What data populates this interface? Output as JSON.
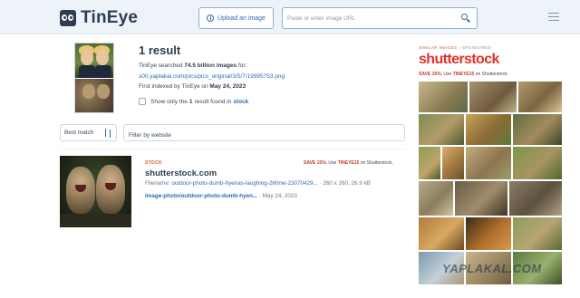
{
  "header": {
    "logo_text": "TinEye",
    "upload_label": "Upload an image",
    "url_placeholder": "Paste or enter image URL"
  },
  "summary": {
    "result_count": "1 result",
    "searched_prefix": "TinEye searched ",
    "searched_count": "74.5 billion images",
    "searched_suffix": " for:",
    "image_url": "s00.yaplakal.com/pics/pics_original/3/5/7/19995753.png",
    "indexed_prefix": "First indexed by TinEye on ",
    "indexed_date": "May 24, 2023",
    "only_prefix": "Show only the",
    "only_count": "1",
    "only_mid": "result found in",
    "only_source": "stock"
  },
  "filters": {
    "sort_value": "Best match",
    "filter_placeholder": "Filter by website"
  },
  "result": {
    "badge": "STOCK",
    "promo_save": "SAVE 15%.",
    "promo_mid": " Use ",
    "promo_code": "TINEYE15",
    "promo_end": " on Shutterstock.",
    "site": "shutterstock.com",
    "filename_label": "Filename: ",
    "filename": "outdoor-photo-dumb-hyenas-laughing-260nw-23070429...",
    "dims": " · 260 x 260, 26.9 kB",
    "page_link": "image-photo/outdoor-photo-dumb-hyen...",
    "page_date": " · May 24, 2023"
  },
  "sidebar": {
    "ad_label": "SIMILAR IMAGES",
    "sponsored": "SPONSORED",
    "brand": "shutterstock",
    "promo_save": "SAVE 15%.",
    "promo_mid": " Use ",
    "promo_code": "TINEYE15",
    "promo_end": " on Shutterstock."
  },
  "watermark": "YAPLAKAL.COM",
  "colors": {
    "header_bg": "#eef3f9",
    "link": "#2d6cb5",
    "brand_red": "#e0312b",
    "text_dark": "#2d3e52"
  }
}
